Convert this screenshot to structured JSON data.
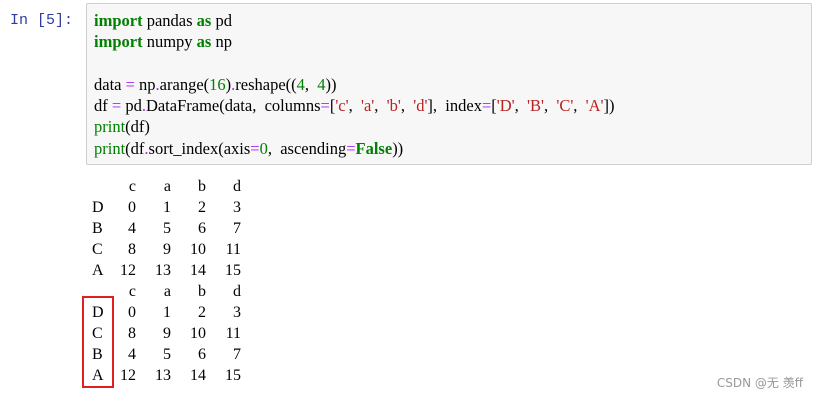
{
  "prompt_label": "In  [5]:",
  "code_lines": [
    [
      {
        "t": "import",
        "c": "kw"
      },
      {
        "t": " pandas "
      },
      {
        "t": "as",
        "c": "kw"
      },
      {
        "t": " pd"
      }
    ],
    [
      {
        "t": "import",
        "c": "kw"
      },
      {
        "t": " numpy "
      },
      {
        "t": "as",
        "c": "kw"
      },
      {
        "t": " np"
      }
    ],
    [
      {
        "t": ""
      }
    ],
    [
      {
        "t": "data "
      },
      {
        "t": "=",
        "c": "op"
      },
      {
        "t": " np"
      },
      {
        "t": ".",
        "c": "op"
      },
      {
        "t": "arange("
      },
      {
        "t": "16",
        "c": "num"
      },
      {
        "t": ")"
      },
      {
        "t": ".",
        "c": "op"
      },
      {
        "t": "reshape(("
      },
      {
        "t": "4",
        "c": "num"
      },
      {
        "t": ",  "
      },
      {
        "t": "4",
        "c": "num"
      },
      {
        "t": "))"
      }
    ],
    [
      {
        "t": "df "
      },
      {
        "t": "=",
        "c": "op"
      },
      {
        "t": " pd"
      },
      {
        "t": ".",
        "c": "op"
      },
      {
        "t": "DataFrame(data,  columns"
      },
      {
        "t": "=",
        "c": "op"
      },
      {
        "t": "["
      },
      {
        "t": "'c'",
        "c": "str"
      },
      {
        "t": ",  "
      },
      {
        "t": "'a'",
        "c": "str"
      },
      {
        "t": ",  "
      },
      {
        "t": "'b'",
        "c": "str"
      },
      {
        "t": ",  "
      },
      {
        "t": "'d'",
        "c": "str"
      },
      {
        "t": "],  index"
      },
      {
        "t": "=",
        "c": "op"
      },
      {
        "t": "["
      },
      {
        "t": "'D'",
        "c": "str"
      },
      {
        "t": ",  "
      },
      {
        "t": "'B'",
        "c": "str"
      },
      {
        "t": ",  "
      },
      {
        "t": "'C'",
        "c": "str"
      },
      {
        "t": ",  "
      },
      {
        "t": "'A'",
        "c": "str"
      },
      {
        "t": "])"
      }
    ],
    [
      {
        "t": "print",
        "c": "bi"
      },
      {
        "t": "(df)"
      }
    ],
    [
      {
        "t": "print",
        "c": "bi"
      },
      {
        "t": "(df"
      },
      {
        "t": ".",
        "c": "op"
      },
      {
        "t": "sort_index(axis"
      },
      {
        "t": "=",
        "c": "op"
      },
      {
        "t": "0",
        "c": "num"
      },
      {
        "t": ",  ascending"
      },
      {
        "t": "=",
        "c": "op"
      },
      {
        "t": "False",
        "c": "kw"
      },
      {
        "t": "))"
      }
    ]
  ],
  "outputs": [
    {
      "columns": [
        "c",
        "a",
        "b",
        "d"
      ],
      "rows": [
        {
          "index": "D",
          "values": [
            "0",
            "1",
            "2",
            "3"
          ]
        },
        {
          "index": "B",
          "values": [
            "4",
            "5",
            "6",
            "7"
          ]
        },
        {
          "index": "C",
          "values": [
            "8",
            "9",
            "10",
            "11"
          ]
        },
        {
          "index": "A",
          "values": [
            "12",
            "13",
            "14",
            "15"
          ]
        }
      ]
    },
    {
      "columns": [
        "c",
        "a",
        "b",
        "d"
      ],
      "rows": [
        {
          "index": "D",
          "values": [
            "0",
            "1",
            "2",
            "3"
          ]
        },
        {
          "index": "C",
          "values": [
            "8",
            "9",
            "10",
            "11"
          ]
        },
        {
          "index": "B",
          "values": [
            "4",
            "5",
            "6",
            "7"
          ]
        },
        {
          "index": "A",
          "values": [
            "12",
            "13",
            "14",
            "15"
          ]
        }
      ]
    }
  ],
  "watermark": "CSDN @无 羡ff",
  "colors": {
    "highlight_box": "#e02020",
    "prompt": "#303f9f",
    "cell_bg": "#f7f7f7"
  }
}
